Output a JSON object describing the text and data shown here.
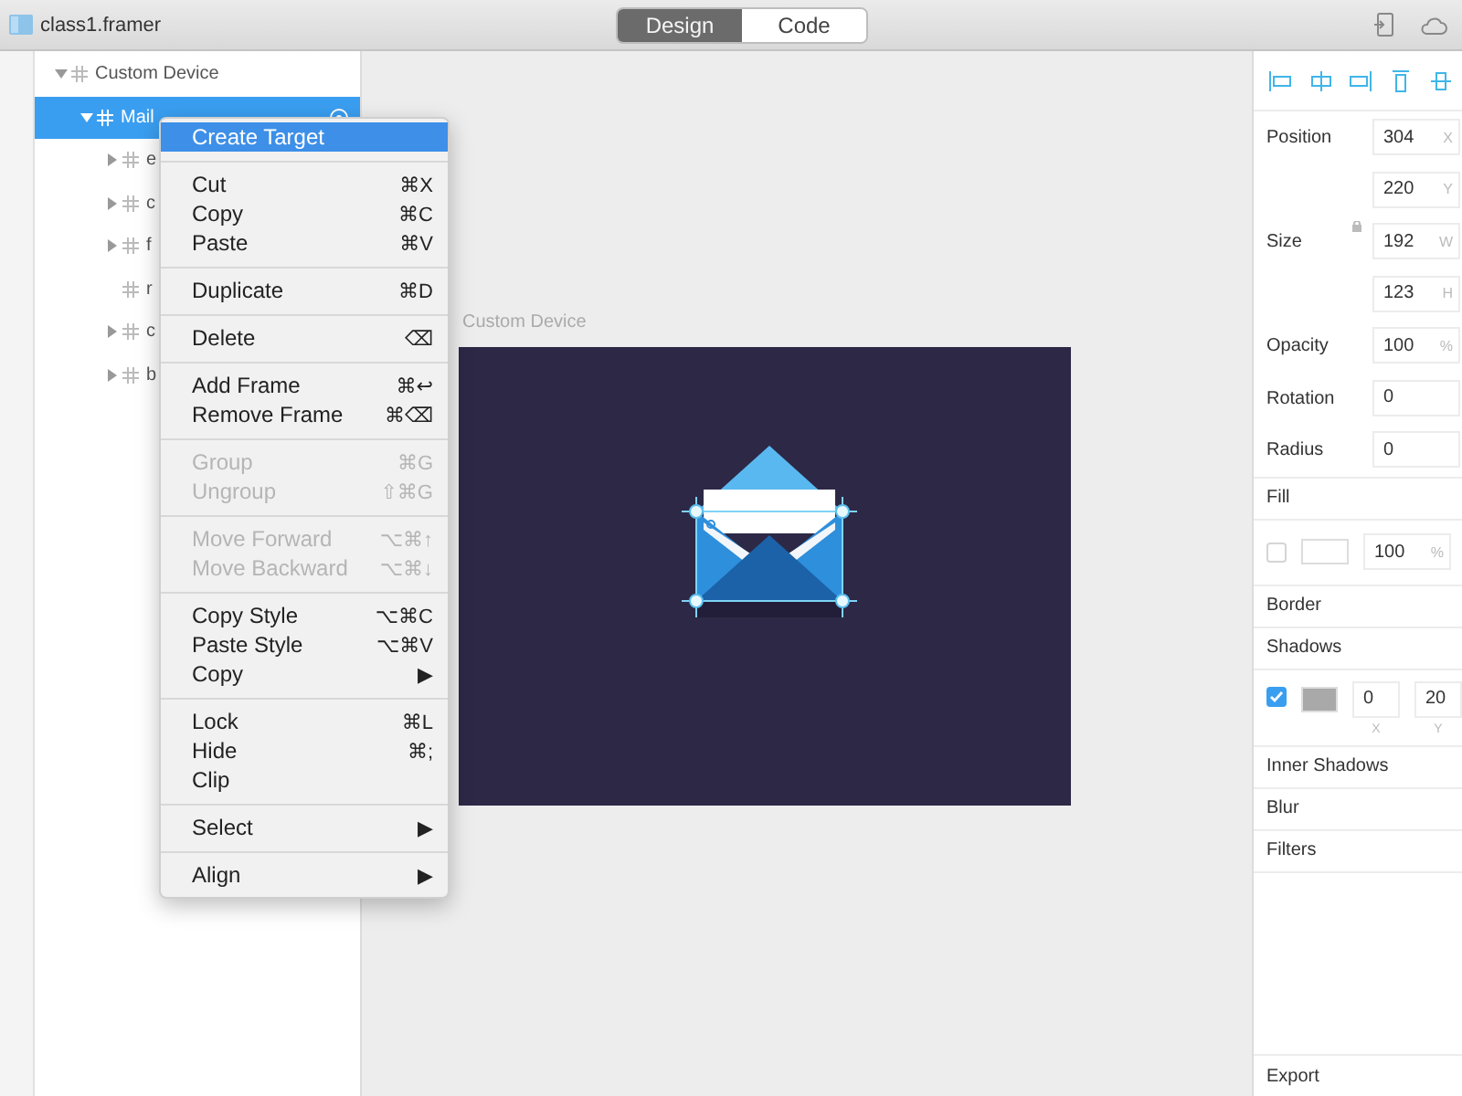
{
  "window": {
    "title": "class1.framer"
  },
  "mode_tabs": [
    {
      "label": "Design",
      "selected": true
    },
    {
      "label": "Code",
      "selected": false
    }
  ],
  "layers": [
    {
      "name": "Custom Device",
      "kind": "group",
      "expanded": true,
      "selected": false,
      "children": [
        {
          "name": "Mail",
          "kind": "group",
          "expanded": true,
          "selected": true,
          "children": [
            {
              "name": "e",
              "kind": "group",
              "expanded": false,
              "selected": false
            },
            {
              "name": "c",
              "kind": "group",
              "expanded": false,
              "selected": false
            },
            {
              "name": "f",
              "kind": "group",
              "expanded": false,
              "selected": false
            },
            {
              "name": "r",
              "kind": "leaf",
              "selected": false
            },
            {
              "name": "c",
              "kind": "group",
              "expanded": false,
              "selected": false
            },
            {
              "name": "b",
              "kind": "group",
              "expanded": false,
              "selected": false
            }
          ]
        }
      ]
    }
  ],
  "canvas": {
    "artboard": {
      "label": "Custom Device"
    }
  },
  "context_menu": {
    "sections": [
      {
        "items": [
          {
            "label": "Create Target",
            "selected": true,
            "disabled": false
          }
        ]
      },
      {
        "items": [
          {
            "label": "Cut",
            "shortcut": "⌘X",
            "selected": false,
            "disabled": false
          },
          {
            "label": "Copy",
            "shortcut": "⌘C",
            "selected": false,
            "disabled": false
          },
          {
            "label": "Paste",
            "shortcut": "⌘V",
            "selected": false,
            "disabled": false
          }
        ]
      },
      {
        "items": [
          {
            "label": "Duplicate",
            "shortcut": "⌘D",
            "selected": false,
            "disabled": false
          }
        ]
      },
      {
        "items": [
          {
            "label": "Delete",
            "shortcut": "⌫",
            "selected": false,
            "disabled": false
          }
        ]
      },
      {
        "items": [
          {
            "label": "Add Frame",
            "shortcut": "⌘↩",
            "selected": false,
            "disabled": false
          },
          {
            "label": "Remove Frame",
            "shortcut": "⌘⌫",
            "selected": false,
            "disabled": false
          }
        ]
      },
      {
        "items": [
          {
            "label": "Group",
            "shortcut": "⌘G",
            "selected": false,
            "disabled": true
          },
          {
            "label": "Ungroup",
            "shortcut": "⇧⌘G",
            "selected": false,
            "disabled": true
          }
        ]
      },
      {
        "items": [
          {
            "label": "Move Forward",
            "shortcut": "⌥⌘↑",
            "selected": false,
            "disabled": true
          },
          {
            "label": "Move Backward",
            "shortcut": "⌥⌘↓",
            "selected": false,
            "disabled": true
          }
        ]
      },
      {
        "items": [
          {
            "label": "Copy Style",
            "shortcut": "⌥⌘C",
            "selected": false,
            "disabled": false
          },
          {
            "label": "Paste Style",
            "shortcut": "⌥⌘V",
            "selected": false,
            "disabled": false
          },
          {
            "label": "Copy",
            "shortcut": "▶",
            "selected": false,
            "disabled": false
          }
        ]
      },
      {
        "items": [
          {
            "label": "Lock",
            "shortcut": "⌘L",
            "selected": false,
            "disabled": false
          },
          {
            "label": "Hide",
            "shortcut": "⌘;",
            "selected": false,
            "disabled": false
          },
          {
            "label": "Clip",
            "selected": false,
            "disabled": false
          }
        ]
      },
      {
        "items": [
          {
            "label": "Select",
            "shortcut": "▶",
            "selected": false,
            "disabled": false
          }
        ]
      },
      {
        "items": [
          {
            "label": "Align",
            "shortcut": "▶",
            "selected": false,
            "disabled": false
          }
        ]
      }
    ]
  },
  "properties": {
    "rows": [
      {
        "kind": "field",
        "label": "Position",
        "value": "304",
        "unit": "X"
      },
      {
        "kind": "field",
        "value": "220",
        "unit": "Y"
      },
      {
        "kind": "field",
        "label": "Size",
        "value": "192",
        "unit": "W",
        "lock": true
      },
      {
        "kind": "field",
        "value": "123",
        "unit": "H"
      },
      {
        "kind": "field",
        "label": "Opacity",
        "value": "100",
        "unit": "%"
      },
      {
        "kind": "field",
        "label": "Rotation",
        "value": "0"
      },
      {
        "kind": "field",
        "label": "Radius",
        "value": "0"
      },
      {
        "kind": "header",
        "label": "Fill"
      },
      {
        "kind": "fill",
        "enabled": false,
        "color": "#ffffff",
        "value": "100",
        "unit": "%"
      },
      {
        "kind": "header",
        "label": "Border"
      },
      {
        "kind": "header",
        "label": "Shadows"
      },
      {
        "kind": "shadow",
        "enabled": true,
        "color": "#a9a9a9",
        "values": [
          {
            "value": "0",
            "unit": "X"
          },
          {
            "value": "20",
            "unit": "Y"
          }
        ]
      },
      {
        "kind": "header",
        "label": "Inner Shadows"
      },
      {
        "kind": "header",
        "label": "Blur"
      },
      {
        "kind": "header",
        "label": "Filters"
      }
    ],
    "footer": "Export"
  }
}
